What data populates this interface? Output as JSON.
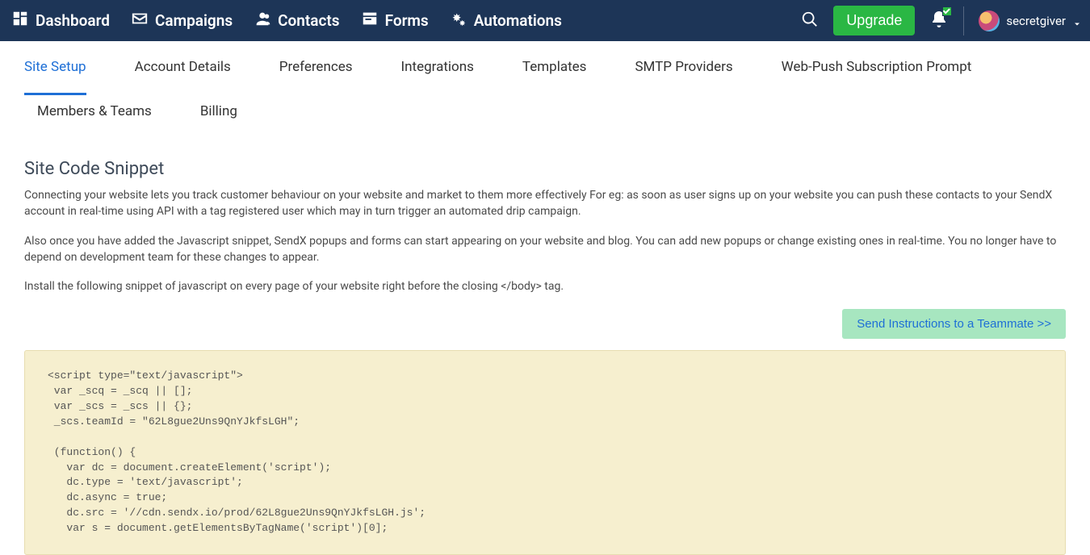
{
  "nav": {
    "dashboard": "Dashboard",
    "campaigns": "Campaigns",
    "contacts": "Contacts",
    "forms": "Forms",
    "automations": "Automations",
    "upgrade": "Upgrade",
    "username": "secretgiver"
  },
  "tabs": {
    "site_setup": "Site Setup",
    "account_details": "Account Details",
    "preferences": "Preferences",
    "integrations": "Integrations",
    "templates": "Templates",
    "smtp_providers": "SMTP Providers",
    "webpush": "Web-Push Subscription Prompt",
    "members_teams": "Members & Teams",
    "billing": "Billing"
  },
  "section": {
    "title": "Site Code Snippet",
    "p1": "Connecting your website lets you track customer behaviour on your website and market to them more effectively For eg: as soon as user signs up on your website you can push these contacts to your SendX account in real-time using API with a tag registered user which may in turn trigger an automated drip campaign.",
    "p2": "Also once you have added the Javascript snippet, SendX popups and forms can start appearing on your website and blog. You can add new popups or change existing ones in real-time. You no longer have to depend on development team for these changes to appear.",
    "p3": "Install the following snippet of javascript on every page of your website right before the closing </body> tag.",
    "send_instructions": "Send Instructions to a Teammate >>",
    "code": "<script type=\"text/javascript\">\n var _scq = _scq || [];\n var _scs = _scs || {};\n _scs.teamId = \"62L8gue2Uns9QnYJkfsLGH\";\n\n (function() {\n   var dc = document.createElement('script');\n   dc.type = 'text/javascript';\n   dc.async = true;\n   dc.src = '//cdn.sendx.io/prod/62L8gue2Uns9QnYJkfsLGH.js';\n   var s = document.getElementsByTagName('script')[0];"
  }
}
